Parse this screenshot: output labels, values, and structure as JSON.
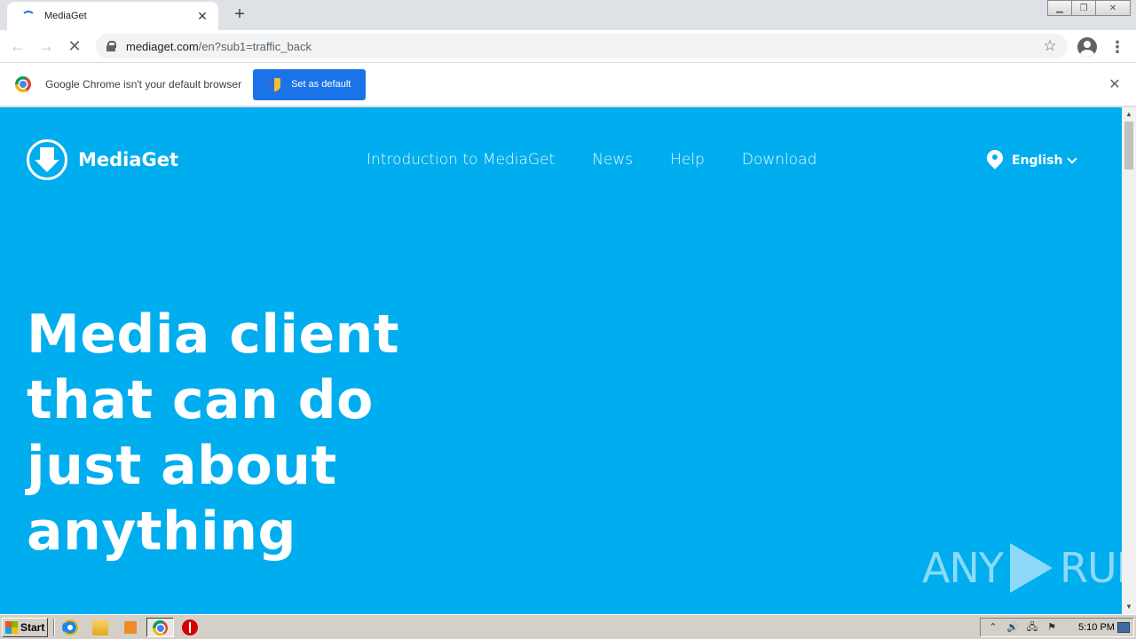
{
  "browser": {
    "tab_title": "MediaGet",
    "tab_close_glyph": "✕",
    "new_tab_glyph": "+",
    "url_host": "mediaget.com",
    "url_rest": "/en?sub1=traffic_back",
    "back_glyph": "←",
    "forward_glyph": "→",
    "reload_glyph": "✕",
    "star_glyph": "☆",
    "menu_glyph": "⋮",
    "window_minimize": "▁",
    "window_restore": "❐",
    "window_close": "✕"
  },
  "infobar": {
    "message": "Google Chrome isn't your default browser",
    "button_label": "Set as default",
    "close_glyph": "✕"
  },
  "site": {
    "logo_text": "MediaGet",
    "nav": [
      {
        "label": "Introduction to MediaGet"
      },
      {
        "label": "News"
      },
      {
        "label": "Help"
      },
      {
        "label": "Download"
      }
    ],
    "language": "English",
    "hero_lines": [
      "Media client",
      "that can do",
      "just about",
      "anything"
    ],
    "brand_color": "#00adef"
  },
  "watermark": {
    "left": "ANY",
    "right": "RUN"
  },
  "scrollbar": {
    "up_glyph": "▲",
    "down_glyph": "▼"
  },
  "taskbar": {
    "start_label": "Start",
    "tray_glyphs": [
      "⌃",
      "🔊",
      "🖧",
      "⚑"
    ],
    "clock": "5:10 PM"
  }
}
